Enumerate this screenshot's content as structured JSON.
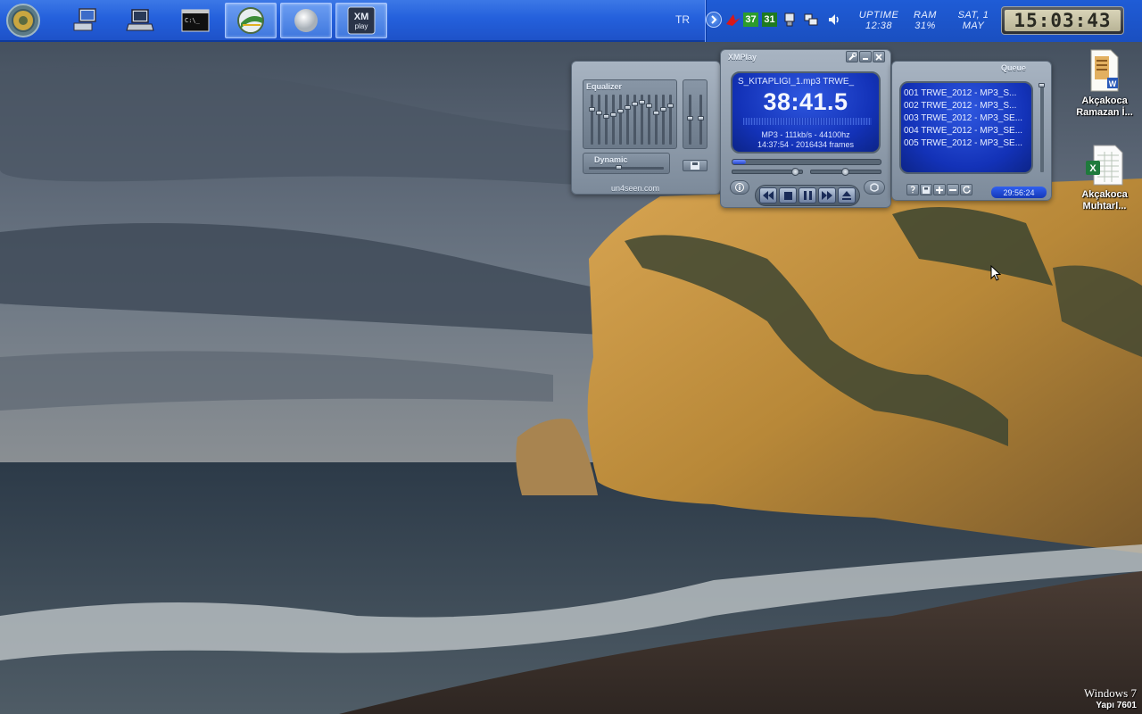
{
  "taskbar": {
    "buttons": [
      {
        "name": "start-orb",
        "icon": "start-orb-icon"
      },
      {
        "name": "computer-shortcut",
        "icon": "computer-icon"
      },
      {
        "name": "laptop-shortcut",
        "icon": "laptop-icon"
      },
      {
        "name": "command-prompt",
        "icon": "terminal-icon"
      },
      {
        "name": "browser-task",
        "icon": "browser-globe-icon",
        "active": true
      },
      {
        "name": "white-orb-task",
        "icon": "orb-icon",
        "active": true
      },
      {
        "name": "xmplay-task",
        "icon": "xmplay-icon",
        "label": "XM play",
        "active": true
      }
    ],
    "language": "TR",
    "tray": {
      "counter_a": "37",
      "counter_b": "31",
      "uptime_label": "UPTIME",
      "uptime_value": "12:38",
      "ram_label": "RAM",
      "ram_value": "31%",
      "date_line1": "SAT, 1",
      "date_line2": "MAY",
      "clock": "15:03:43"
    }
  },
  "xmplay": {
    "title": "XMPlay",
    "equalizer_label": "Equalizer",
    "dynamic_label": "Dynamic",
    "brand_label": "un4seen.com",
    "song_title": "S_KITAPLIĞI_1.mp3     TRWE_",
    "elapsed": "38:41.5",
    "format_info": "MP3 - 111kb/s - 44100hz",
    "length_info": "14:37:54 - 2016434 frames",
    "seek_progress": 0.09,
    "queue_label": "Queue",
    "queue": [
      "001 TRWE_2012 - MP3_S...",
      "002 TRWE_2012 - MP3_S...",
      "003 TRWE_2012 - MP3_SE...",
      "004 TRWE_2012 - MP3_SE...",
      "005 TRWE_2012 - MP3_SE..."
    ],
    "queue_total": "29:56:24",
    "colors": {
      "screen": "#1a3cc8",
      "chrome": "#8f9cab"
    }
  },
  "desktop": {
    "icons": [
      {
        "name": "desktop-icon-word-doc",
        "icon": "word-document-icon",
        "label": "Akçakoca Ramazan İ..."
      },
      {
        "name": "desktop-icon-excel-doc",
        "icon": "excel-document-icon",
        "label": "Akçakoca Muhtarl..."
      }
    ],
    "watermark_line1": "Windows 7",
    "watermark_line2": "Yapı 7601"
  }
}
